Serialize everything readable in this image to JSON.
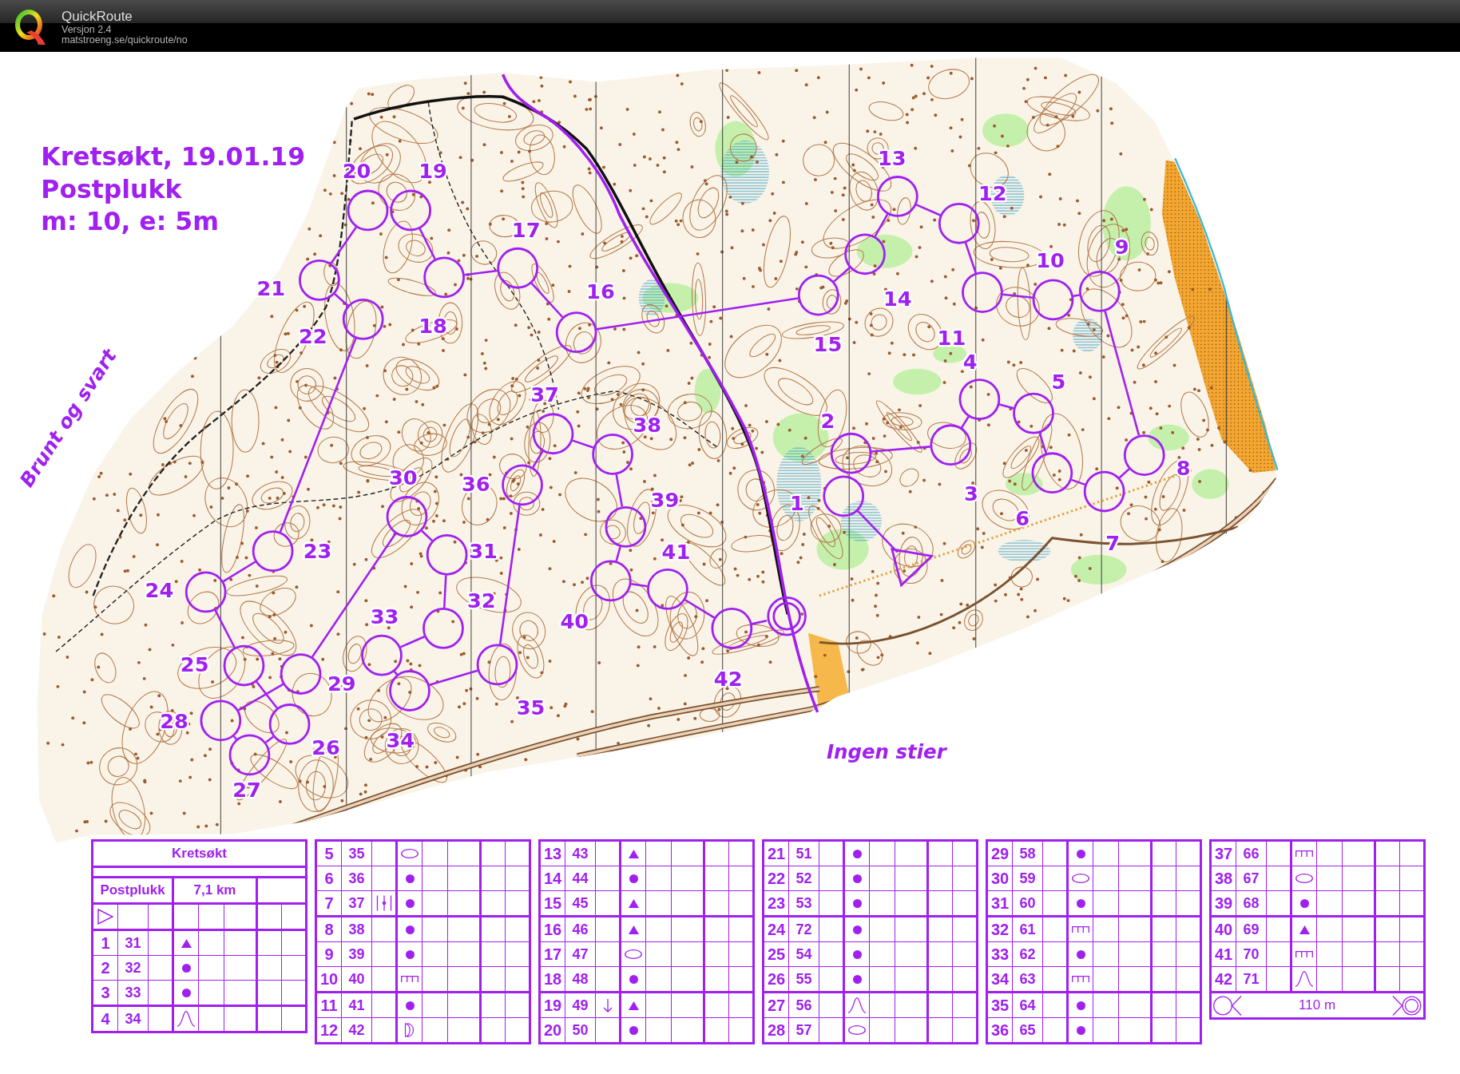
{
  "app": {
    "title": "QuickRoute",
    "version": "Versjon 2.4",
    "url": "matstroeng.se/quickroute/no"
  },
  "map": {
    "title_lines": [
      "Kretsøkt, 19.01.19",
      "Postplukk",
      "m: 10, e: 5m"
    ],
    "notes": [
      "Brunt og svart",
      "Ingen stier"
    ],
    "controls": [
      {
        "number": "1"
      },
      {
        "number": "2"
      },
      {
        "number": "3"
      },
      {
        "number": "4"
      },
      {
        "number": "5"
      },
      {
        "number": "6"
      },
      {
        "number": "7"
      },
      {
        "number": "8"
      },
      {
        "number": "9"
      },
      {
        "number": "10"
      },
      {
        "number": "11"
      },
      {
        "number": "12"
      },
      {
        "number": "13"
      },
      {
        "number": "14"
      },
      {
        "number": "15"
      },
      {
        "number": "16"
      },
      {
        "number": "17"
      },
      {
        "number": "18"
      },
      {
        "number": "19"
      },
      {
        "number": "20"
      },
      {
        "number": "21"
      },
      {
        "number": "22"
      },
      {
        "number": "23"
      },
      {
        "number": "24"
      },
      {
        "number": "25"
      },
      {
        "number": "26"
      },
      {
        "number": "27"
      },
      {
        "number": "28"
      },
      {
        "number": "29"
      },
      {
        "number": "30"
      },
      {
        "number": "31"
      },
      {
        "number": "32"
      },
      {
        "number": "33"
      },
      {
        "number": "34"
      },
      {
        "number": "35"
      },
      {
        "number": "36"
      },
      {
        "number": "37"
      },
      {
        "number": "38"
      },
      {
        "number": "39"
      },
      {
        "number": "40"
      },
      {
        "number": "41"
      },
      {
        "number": "42"
      }
    ]
  },
  "description_sheet": {
    "event": "Kretsøkt",
    "course": "Postplukk",
    "length": "7,1 km",
    "controls": [
      {
        "number": "1",
        "code": "31",
        "kind": "triangle"
      },
      {
        "number": "2",
        "code": "32",
        "kind": "dot"
      },
      {
        "number": "3",
        "code": "33",
        "kind": "dot"
      },
      {
        "number": "4",
        "code": "34",
        "kind": "bell"
      },
      {
        "number": "5",
        "code": "35",
        "kind": "oval"
      },
      {
        "number": "6",
        "code": "36",
        "kind": "dot"
      },
      {
        "number": "7",
        "code": "37",
        "kind": "dot",
        "column_c": {
          "kind": "bars"
        }
      },
      {
        "number": "8",
        "code": "38",
        "kind": "dot"
      },
      {
        "number": "9",
        "code": "39",
        "kind": "dot"
      },
      {
        "number": "10",
        "code": "40",
        "kind": "comb"
      },
      {
        "number": "11",
        "code": "41",
        "kind": "dot"
      },
      {
        "number": "12",
        "code": "42",
        "kind": "arc"
      },
      {
        "number": "13",
        "code": "43",
        "kind": "triangle"
      },
      {
        "number": "14",
        "code": "44",
        "kind": "dot"
      },
      {
        "number": "15",
        "code": "45",
        "kind": "triangle"
      },
      {
        "number": "16",
        "code": "46",
        "kind": "triangle"
      },
      {
        "number": "17",
        "code": "47",
        "kind": "oval"
      },
      {
        "number": "18",
        "code": "48",
        "kind": "dot"
      },
      {
        "number": "19",
        "code": "49",
        "kind": "triangle",
        "column_c": {
          "kind": "arrow"
        }
      },
      {
        "number": "20",
        "code": "50",
        "kind": "dot"
      },
      {
        "number": "21",
        "code": "51",
        "kind": "dot"
      },
      {
        "number": "22",
        "code": "52",
        "kind": "dot"
      },
      {
        "number": "23",
        "code": "53",
        "kind": "dot"
      },
      {
        "number": "24",
        "code": "72",
        "kind": "dot"
      },
      {
        "number": "25",
        "code": "54",
        "kind": "dot"
      },
      {
        "number": "26",
        "code": "55",
        "kind": "dot"
      },
      {
        "number": "27",
        "code": "56",
        "kind": "bell"
      },
      {
        "number": "28",
        "code": "57",
        "kind": "oval"
      },
      {
        "number": "29",
        "code": "58",
        "kind": "dot"
      },
      {
        "number": "30",
        "code": "59",
        "kind": "oval"
      },
      {
        "number": "31",
        "code": "60",
        "kind": "dot"
      },
      {
        "number": "32",
        "code": "61",
        "kind": "comb"
      },
      {
        "number": "33",
        "code": "62",
        "kind": "dot"
      },
      {
        "number": "34",
        "code": "63",
        "kind": "comb"
      },
      {
        "number": "35",
        "code": "64",
        "kind": "dot"
      },
      {
        "number": "36",
        "code": "65",
        "kind": "dot"
      },
      {
        "number": "37",
        "code": "66",
        "kind": "comb"
      },
      {
        "number": "38",
        "code": "67",
        "kind": "oval"
      },
      {
        "number": "39",
        "code": "68",
        "kind": "dot"
      },
      {
        "number": "40",
        "code": "69",
        "kind": "triangle"
      },
      {
        "number": "41",
        "code": "70",
        "kind": "comb"
      },
      {
        "number": "42",
        "code": "71",
        "kind": "bell"
      }
    ],
    "finish": {
      "distance": "110 m"
    }
  }
}
